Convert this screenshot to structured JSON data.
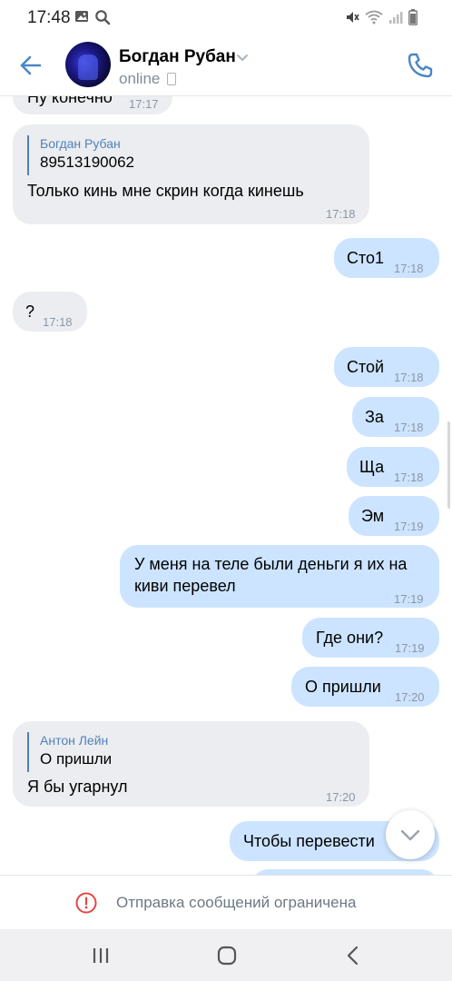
{
  "status_bar": {
    "time": "17:48",
    "icons_left": [
      "image-icon",
      "search-icon"
    ],
    "icons_right": [
      "mute-icon",
      "wifi-icon",
      "signal-icon",
      "battery-icon"
    ]
  },
  "header": {
    "contact_name": "Богдан Рубан",
    "status": "online",
    "accent": "#4a86c6"
  },
  "messages": [
    {
      "dir": "in",
      "text": "Ну конечно",
      "time": "17:17"
    },
    {
      "dir": "in",
      "reply": {
        "author": "Богдан Рубан",
        "text": "89513190062"
      },
      "text": "Только кинь мне скрин когда кинешь",
      "time": "17:18"
    },
    {
      "dir": "out",
      "text": "Сто1",
      "time": "17:18"
    },
    {
      "dir": "in",
      "text": "?",
      "time": "17:18"
    },
    {
      "dir": "out",
      "text": "Стой",
      "time": "17:18"
    },
    {
      "dir": "out",
      "text": "За",
      "time": "17:18"
    },
    {
      "dir": "out",
      "text": "Ща",
      "time": "17:18"
    },
    {
      "dir": "out",
      "text": "Эм",
      "time": "17:19"
    },
    {
      "dir": "out",
      "text_line1": "У меня на теле были деньги я их на",
      "text_line2": "киви перевел",
      "time": "17:19"
    },
    {
      "dir": "out",
      "text": "Где они?",
      "time": "17:19"
    },
    {
      "dir": "out",
      "text": "О пришли",
      "time": "17:20"
    },
    {
      "dir": "in",
      "reply": {
        "author": "Антон Лейн",
        "text": "О пришли"
      },
      "text": "Я бы угарнул",
      "time": "17:20"
    },
    {
      "dir": "out",
      "text": "Чтобы перевести",
      "time": ""
    }
  ],
  "restricted": {
    "text": "Отправка сообщений ограничена",
    "icon": "alert-circle-icon",
    "color": "#e64646"
  },
  "colors": {
    "incoming_bubble": "#ebedf0",
    "outgoing_bubble": "#cce4ff",
    "reply_author": "#5181b8"
  }
}
